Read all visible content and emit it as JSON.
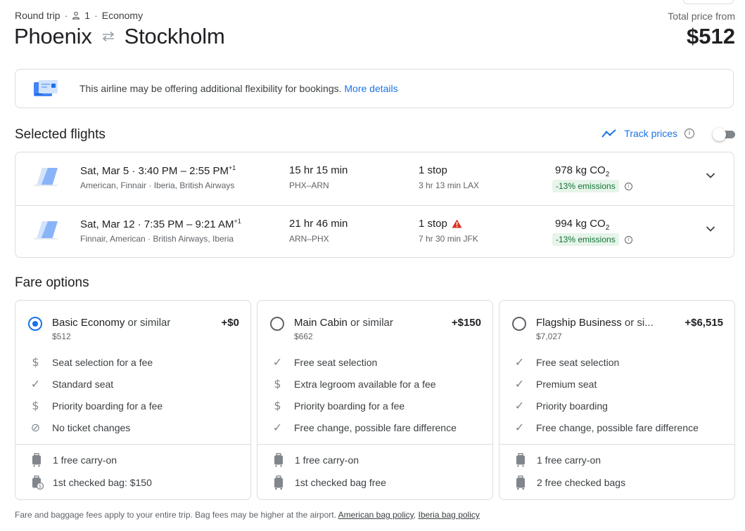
{
  "trip": {
    "type": "Round trip",
    "passengers": "1",
    "cabin": "Economy",
    "origin": "Phoenix",
    "destination": "Stockholm",
    "total_label": "Total price from",
    "total_price": "$512"
  },
  "banner": {
    "text": "This airline may be offering additional flexibility for bookings.",
    "link": "More details"
  },
  "selected": {
    "title": "Selected flights",
    "track_label": "Track prices"
  },
  "flights": [
    {
      "date": "Sat, Mar 5",
      "depart": "3:40 PM",
      "arrive": "2:55 PM",
      "day_offset": "+1",
      "airlines": "American, Finnair · Iberia, British Airways",
      "duration": "15 hr 15 min",
      "route": "PHX–ARN",
      "stops": "1 stop",
      "layover": "3 hr 13 min LAX",
      "co2": "978 kg CO",
      "emissions": "-13% emissions",
      "warning": false
    },
    {
      "date": "Sat, Mar 12",
      "depart": "7:35 PM",
      "arrive": "9:21 AM",
      "day_offset": "+1",
      "airlines": "Finnair, American · British Airways, Iberia",
      "duration": "21 hr 46 min",
      "route": "ARN–PHX",
      "stops": "1 stop",
      "layover": "7 hr 30 min JFK",
      "co2": "994 kg CO",
      "emissions": "-13% emissions",
      "warning": true
    }
  ],
  "fares": {
    "title": "Fare options",
    "options": [
      {
        "name": "Basic Economy",
        "suffix": " or similar",
        "price": "$512",
        "delta": "+$0",
        "selected": true,
        "features": [
          {
            "icon": "dollar-icon",
            "text": "Seat selection for a fee"
          },
          {
            "icon": "check-icon",
            "text": "Standard seat"
          },
          {
            "icon": "dollar-icon",
            "text": "Priority boarding for a fee"
          },
          {
            "icon": "no-icon",
            "text": "No ticket changes"
          }
        ],
        "bags": [
          {
            "icon": "carry-on-icon",
            "text": "1 free carry-on"
          },
          {
            "icon": "checked-bag-fee-icon",
            "text": "1st checked bag: $150"
          }
        ]
      },
      {
        "name": "Main Cabin",
        "suffix": " or similar",
        "price": "$662",
        "delta": "+$150",
        "selected": false,
        "features": [
          {
            "icon": "check-icon",
            "text": "Free seat selection"
          },
          {
            "icon": "dollar-icon",
            "text": "Extra legroom available for a fee"
          },
          {
            "icon": "dollar-icon",
            "text": "Priority boarding for a fee"
          },
          {
            "icon": "check-icon",
            "text": "Free change, possible fare difference"
          }
        ],
        "bags": [
          {
            "icon": "carry-on-icon",
            "text": "1 free carry-on"
          },
          {
            "icon": "checked-bag-icon",
            "text": "1st checked bag free"
          }
        ]
      },
      {
        "name": "Flagship Business",
        "suffix": " or si...",
        "price": "$7,027",
        "delta": "+$6,515",
        "selected": false,
        "features": [
          {
            "icon": "check-icon",
            "text": "Free seat selection"
          },
          {
            "icon": "check-icon",
            "text": "Premium seat"
          },
          {
            "icon": "check-icon",
            "text": "Priority boarding"
          },
          {
            "icon": "check-icon",
            "text": "Free change, possible fare difference"
          }
        ],
        "bags": [
          {
            "icon": "carry-on-icon",
            "text": "1 free carry-on"
          },
          {
            "icon": "checked-bag-icon",
            "text": "2 free checked bags"
          }
        ]
      }
    ]
  },
  "footer": {
    "text": "Fare and baggage fees apply to your entire trip. Bag fees may be higher at the airport.",
    "link1": "American bag policy",
    "sep": ",",
    "link2": "Iberia bag policy"
  }
}
